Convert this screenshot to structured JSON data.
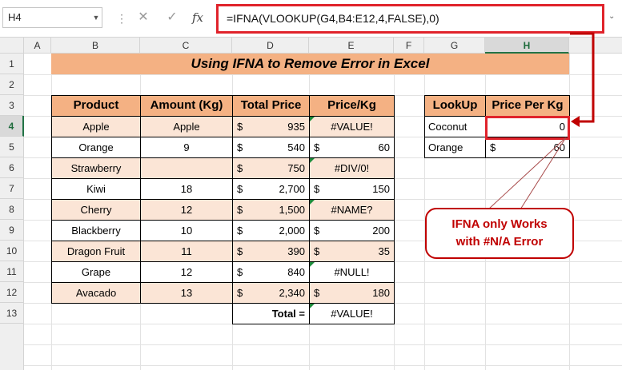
{
  "formula_bar": {
    "name_box": "H4",
    "formula": "=IFNA(VLOOKUP(G4,B4:E12,4,FALSE),0)"
  },
  "icons": {
    "cancel": "close-icon",
    "enter": "check-icon",
    "function": "fx-icon"
  },
  "colors": {
    "title_fill": "#f4b183",
    "row_fill": "#fbe5d6",
    "highlight": "#e0232b",
    "callout": "#c00000"
  },
  "columns": [
    "A",
    "B",
    "C",
    "D",
    "E",
    "F",
    "G",
    "H"
  ],
  "rows": [
    "1",
    "2",
    "3",
    "4",
    "5",
    "6",
    "7",
    "8",
    "9",
    "10",
    "11",
    "12",
    "13"
  ],
  "title": "Using IFNA to Remove Error in Excel",
  "table": {
    "headers": [
      "Product",
      "Amount (Kg)",
      "Total Price",
      "Price/Kg"
    ],
    "rows": [
      {
        "product": "Apple",
        "amount": "Apple",
        "total_sym": "$",
        "total": "935",
        "price_sym": "",
        "price": "#VALUE!"
      },
      {
        "product": "Orange",
        "amount": "9",
        "total_sym": "$",
        "total": "540",
        "price_sym": "$",
        "price": "60"
      },
      {
        "product": "Strawberry",
        "amount": "",
        "total_sym": "$",
        "total": "750",
        "price_sym": "",
        "price": "#DIV/0!"
      },
      {
        "product": "Kiwi",
        "amount": "18",
        "total_sym": "$",
        "total": "2,700",
        "price_sym": "$",
        "price": "150"
      },
      {
        "product": "Cherry",
        "amount": "12",
        "total_sym": "$",
        "total": "1,500",
        "price_sym": "",
        "price": "#NAME?"
      },
      {
        "product": "Blackberry",
        "amount": "10",
        "total_sym": "$",
        "total": "2,000",
        "price_sym": "$",
        "price": "200"
      },
      {
        "product": "Dragon Fruit",
        "amount": "11",
        "total_sym": "$",
        "total": "390",
        "price_sym": "$",
        "price": "35"
      },
      {
        "product": "Grape",
        "amount": "12",
        "total_sym": "$",
        "total": "840",
        "price_sym": "",
        "price": "#NULL!"
      },
      {
        "product": "Avacado",
        "amount": "13",
        "total_sym": "$",
        "total": "2,340",
        "price_sym": "$",
        "price": "180"
      }
    ],
    "total_label": "Total =",
    "total_value": "#VALUE!"
  },
  "lookup": {
    "headers": [
      "LookUp",
      "Price Per Kg"
    ],
    "rows": [
      {
        "key": "Coconut",
        "sym": "",
        "value": "0"
      },
      {
        "key": "Orange",
        "sym": "$",
        "value": "60"
      }
    ]
  },
  "callout": {
    "line1": "IFNA only Works",
    "line2": "with #N/A Error"
  }
}
